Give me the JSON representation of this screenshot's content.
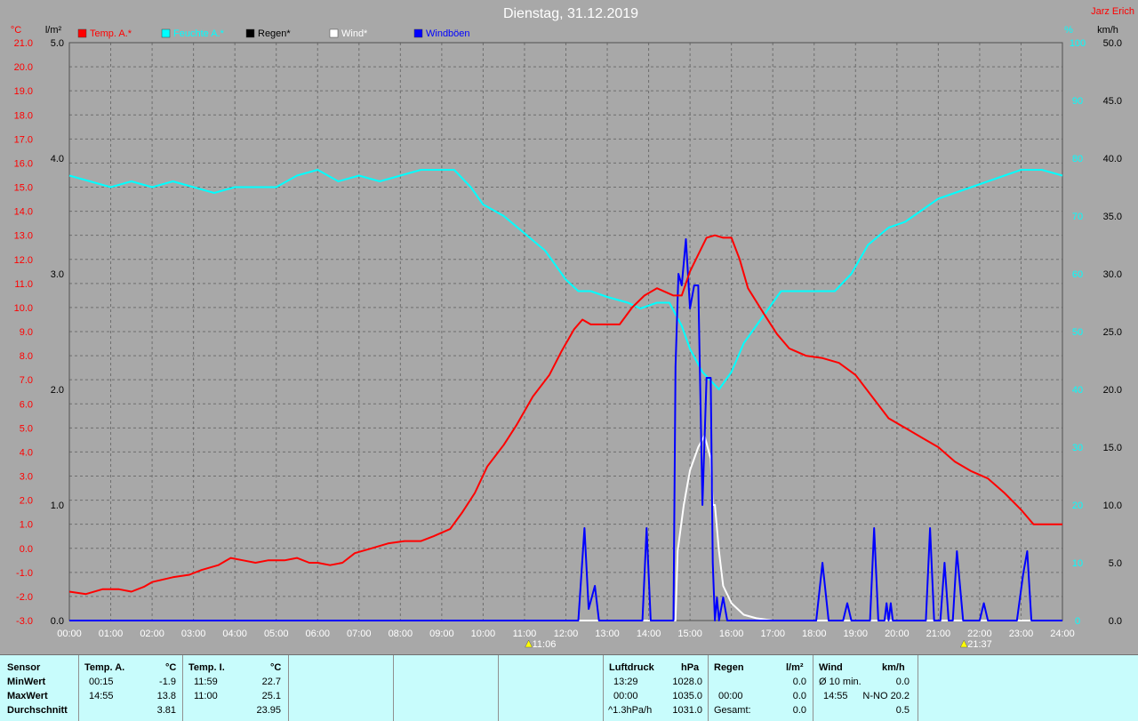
{
  "chart_data": {
    "type": "line",
    "title": "Dienstag, 31.12.2019",
    "author": "Jarz Erich",
    "legend": [
      {
        "label": "Temp. A.*",
        "color": "#ff0000"
      },
      {
        "label": "Feuchte A.*",
        "color": "#00ffff"
      },
      {
        "label": "Regen*",
        "color": "#000000"
      },
      {
        "label": "Wind*",
        "color": "#ffffff"
      },
      {
        "label": "Windböen",
        "color": "#0000ff"
      }
    ],
    "axes": {
      "temp": {
        "unit": "°C",
        "min": -3,
        "max": 21,
        "step": 1,
        "color": "#ff0000"
      },
      "rain": {
        "unit": "l/m²",
        "min": 0,
        "max": 5,
        "step": 1,
        "color": "#000000"
      },
      "humidity": {
        "unit": "%",
        "min": 0,
        "max": 100,
        "step": 10,
        "color": "#00ffff"
      },
      "wind": {
        "unit": "km/h",
        "min": 0,
        "max": 50,
        "step": 5,
        "color": "#000000"
      },
      "x": {
        "min": 0,
        "max": 24,
        "labels": [
          "00:00",
          "01:00",
          "02:00",
          "03:00",
          "04:00",
          "05:00",
          "06:00",
          "07:00",
          "08:00",
          "09:00",
          "10:00",
          "11:00",
          "12:00",
          "13:00",
          "14:00",
          "15:00",
          "16:00",
          "17:00",
          "18:00",
          "19:00",
          "20:00",
          "21:00",
          "22:00",
          "23:00",
          "24:00"
        ]
      }
    },
    "grid": true,
    "markers": [
      {
        "time": 11.1,
        "label": "11:06",
        "kind": "sunrise"
      },
      {
        "time": 21.62,
        "label": "21:37",
        "kind": "sunset"
      }
    ],
    "series": [
      {
        "name": "Temp. A.*",
        "axis": "temp",
        "color": "#ff0000",
        "points": [
          [
            0,
            -1.8
          ],
          [
            0.4,
            -1.9
          ],
          [
            0.8,
            -1.7
          ],
          [
            1.2,
            -1.7
          ],
          [
            1.5,
            -1.8
          ],
          [
            1.8,
            -1.6
          ],
          [
            2.0,
            -1.4
          ],
          [
            2.5,
            -1.2
          ],
          [
            2.9,
            -1.1
          ],
          [
            3.2,
            -0.9
          ],
          [
            3.6,
            -0.7
          ],
          [
            3.9,
            -0.4
          ],
          [
            4.2,
            -0.5
          ],
          [
            4.5,
            -0.6
          ],
          [
            4.8,
            -0.5
          ],
          [
            5.2,
            -0.5
          ],
          [
            5.5,
            -0.4
          ],
          [
            5.8,
            -0.6
          ],
          [
            6.0,
            -0.6
          ],
          [
            6.3,
            -0.7
          ],
          [
            6.6,
            -0.6
          ],
          [
            6.9,
            -0.2
          ],
          [
            7.3,
            0.0
          ],
          [
            7.7,
            0.2
          ],
          [
            8.1,
            0.3
          ],
          [
            8.5,
            0.3
          ],
          [
            8.8,
            0.5
          ],
          [
            9.2,
            0.8
          ],
          [
            9.5,
            1.5
          ],
          [
            9.8,
            2.3
          ],
          [
            10.1,
            3.4
          ],
          [
            10.5,
            4.3
          ],
          [
            10.8,
            5.1
          ],
          [
            11.2,
            6.3
          ],
          [
            11.6,
            7.2
          ],
          [
            11.9,
            8.2
          ],
          [
            12.2,
            9.1
          ],
          [
            12.4,
            9.5
          ],
          [
            12.6,
            9.3
          ],
          [
            13.0,
            9.3
          ],
          [
            13.3,
            9.3
          ],
          [
            13.6,
            10.0
          ],
          [
            13.9,
            10.5
          ],
          [
            14.2,
            10.8
          ],
          [
            14.6,
            10.5
          ],
          [
            14.8,
            10.5
          ],
          [
            15.0,
            11.5
          ],
          [
            15.2,
            12.2
          ],
          [
            15.4,
            12.9
          ],
          [
            15.6,
            13.0
          ],
          [
            15.8,
            12.9
          ],
          [
            16.0,
            12.9
          ],
          [
            16.2,
            12.0
          ],
          [
            16.4,
            10.8
          ],
          [
            16.8,
            9.7
          ],
          [
            17.1,
            8.9
          ],
          [
            17.4,
            8.3
          ],
          [
            17.8,
            8.0
          ],
          [
            18.2,
            7.9
          ],
          [
            18.6,
            7.7
          ],
          [
            19.0,
            7.2
          ],
          [
            19.4,
            6.3
          ],
          [
            19.8,
            5.4
          ],
          [
            20.2,
            5.0
          ],
          [
            20.6,
            4.6
          ],
          [
            21.0,
            4.2
          ],
          [
            21.4,
            3.6
          ],
          [
            21.8,
            3.2
          ],
          [
            22.2,
            2.9
          ],
          [
            22.6,
            2.3
          ],
          [
            23.0,
            1.6
          ],
          [
            23.3,
            1.0
          ],
          [
            23.6,
            1.0
          ],
          [
            24.0,
            1.0
          ]
        ]
      },
      {
        "name": "Feuchte A.*",
        "axis": "humidity",
        "color": "#00ffff",
        "points": [
          [
            0,
            77
          ],
          [
            0.5,
            76
          ],
          [
            1.0,
            75
          ],
          [
            1.5,
            76
          ],
          [
            2.0,
            75
          ],
          [
            2.5,
            76
          ],
          [
            3.0,
            75
          ],
          [
            3.5,
            74
          ],
          [
            4.0,
            75
          ],
          [
            4.5,
            75
          ],
          [
            5.0,
            75
          ],
          [
            5.5,
            77
          ],
          [
            6.0,
            78
          ],
          [
            6.5,
            76
          ],
          [
            7.0,
            77
          ],
          [
            7.5,
            76
          ],
          [
            8.0,
            77
          ],
          [
            8.5,
            78
          ],
          [
            9.0,
            78
          ],
          [
            9.3,
            78
          ],
          [
            9.7,
            75
          ],
          [
            10.0,
            72
          ],
          [
            10.5,
            70
          ],
          [
            11.0,
            67
          ],
          [
            11.5,
            64
          ],
          [
            12.0,
            59
          ],
          [
            12.3,
            57
          ],
          [
            12.6,
            57
          ],
          [
            13.0,
            56
          ],
          [
            13.5,
            55
          ],
          [
            13.8,
            54
          ],
          [
            14.2,
            55
          ],
          [
            14.5,
            55
          ],
          [
            14.8,
            51
          ],
          [
            15.0,
            47
          ],
          [
            15.3,
            43
          ],
          [
            15.7,
            40
          ],
          [
            16.0,
            43
          ],
          [
            16.3,
            48
          ],
          [
            16.8,
            53
          ],
          [
            17.2,
            57
          ],
          [
            17.6,
            57
          ],
          [
            18.0,
            57
          ],
          [
            18.5,
            57
          ],
          [
            18.9,
            60
          ],
          [
            19.3,
            65
          ],
          [
            19.8,
            68
          ],
          [
            20.2,
            69
          ],
          [
            20.6,
            71
          ],
          [
            21.0,
            73
          ],
          [
            21.4,
            74
          ],
          [
            21.8,
            75
          ],
          [
            22.2,
            76
          ],
          [
            22.6,
            77
          ],
          [
            23.0,
            78
          ],
          [
            23.5,
            78
          ],
          [
            24.0,
            77
          ]
        ]
      },
      {
        "name": "Wind*",
        "axis": "wind",
        "color": "#ffffff",
        "points": [
          [
            0,
            0
          ],
          [
            14.65,
            0
          ],
          [
            14.7,
            6
          ],
          [
            14.85,
            10
          ],
          [
            15.0,
            13
          ],
          [
            15.2,
            15
          ],
          [
            15.35,
            16
          ],
          [
            15.5,
            14
          ],
          [
            15.55,
            10
          ],
          [
            15.6,
            10
          ],
          [
            15.7,
            6
          ],
          [
            15.8,
            3
          ],
          [
            16.0,
            1.5
          ],
          [
            16.3,
            0.5
          ],
          [
            16.6,
            0.2
          ],
          [
            17.0,
            0
          ],
          [
            24.0,
            0
          ]
        ]
      },
      {
        "name": "Windböen",
        "axis": "wind",
        "color": "#0000ff",
        "points": [
          [
            0,
            0
          ],
          [
            12.3,
            0
          ],
          [
            12.45,
            8
          ],
          [
            12.55,
            1
          ],
          [
            12.7,
            3
          ],
          [
            12.8,
            0
          ],
          [
            13.85,
            0
          ],
          [
            13.95,
            8
          ],
          [
            14.05,
            0
          ],
          [
            14.6,
            0
          ],
          [
            14.65,
            22
          ],
          [
            14.72,
            30
          ],
          [
            14.8,
            29
          ],
          [
            14.9,
            33
          ],
          [
            15.0,
            27
          ],
          [
            15.1,
            29
          ],
          [
            15.2,
            29
          ],
          [
            15.3,
            10
          ],
          [
            15.4,
            21
          ],
          [
            15.5,
            21
          ],
          [
            15.55,
            5
          ],
          [
            15.6,
            0
          ],
          [
            15.65,
            2
          ],
          [
            15.7,
            0
          ],
          [
            15.8,
            2
          ],
          [
            15.9,
            0
          ],
          [
            18.05,
            0
          ],
          [
            18.2,
            5
          ],
          [
            18.35,
            0
          ],
          [
            18.7,
            0
          ],
          [
            18.8,
            1.5
          ],
          [
            18.9,
            0
          ],
          [
            19.35,
            0
          ],
          [
            19.45,
            8
          ],
          [
            19.55,
            0
          ],
          [
            19.7,
            0
          ],
          [
            19.75,
            1.5
          ],
          [
            19.8,
            0
          ],
          [
            19.85,
            1.5
          ],
          [
            19.9,
            0
          ],
          [
            20.7,
            0
          ],
          [
            20.8,
            8
          ],
          [
            20.9,
            0
          ],
          [
            21.05,
            0
          ],
          [
            21.15,
            5
          ],
          [
            21.25,
            0
          ],
          [
            21.35,
            0
          ],
          [
            21.45,
            6
          ],
          [
            21.6,
            0
          ],
          [
            22.0,
            0
          ],
          [
            22.1,
            1.5
          ],
          [
            22.2,
            0
          ],
          [
            22.9,
            0
          ],
          [
            23.05,
            4
          ],
          [
            23.15,
            6
          ],
          [
            23.25,
            0
          ],
          [
            24.0,
            0
          ]
        ]
      }
    ]
  },
  "table": {
    "row_labels": [
      "Sensor",
      "MinWert",
      "MaxWert",
      "Durchschnitt"
    ],
    "temp_a": {
      "header": "Temp. A.",
      "unit": "°C",
      "min_time": "00:15",
      "min": "-1.9",
      "max_time": "14:55",
      "max": "13.8",
      "avg": "3.81"
    },
    "temp_i": {
      "header": "Temp. I.",
      "unit": "°C",
      "min_time": "11:59",
      "min": "22.7",
      "max_time": "11:00",
      "max": "25.1",
      "avg": "23.95"
    },
    "pressure": {
      "header": "Luftdruck",
      "unit": "hPa",
      "min_time": "13:29",
      "min": "1028.0",
      "max_time": "00:00",
      "max": "1035.0",
      "trend_label": "^1.3hPa/h",
      "trend": "1031.0"
    },
    "rain": {
      "header": "Regen",
      "unit": "l/m²",
      "max_time": "00:00",
      "max": "0.0",
      "total_label": "Gesamt:",
      "total": "0.0",
      "min": "0.0"
    },
    "wind": {
      "header": "Wind",
      "unit": "km/h",
      "avg_label": "Ø 10 min.",
      "avg": "0.0",
      "max_time": "14:55",
      "max": "N-NO 20.2",
      "last": "0.5"
    }
  }
}
